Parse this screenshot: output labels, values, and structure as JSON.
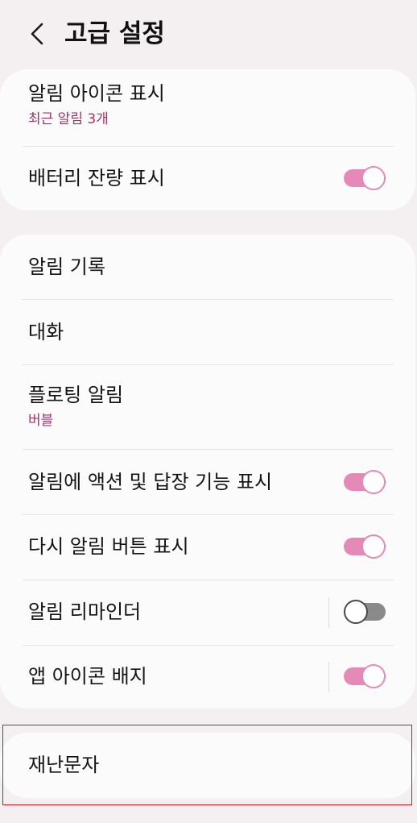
{
  "header": {
    "title": "고급 설정",
    "back_icon": "chevron-left-icon"
  },
  "colors": {
    "background": "#f4f0f1",
    "card": "#fcfbfb",
    "accent": "#e58ab8",
    "subtitle": "#a5316b",
    "toggle_off": "#8a8a8a",
    "highlight_border": "#e8101f"
  },
  "card1": {
    "notification_icons": {
      "title": "알림 아이콘 표시",
      "subtitle": "최근 알림 3개"
    },
    "battery_percentage": {
      "title": "배터리 잔량 표시",
      "toggle_on": true
    }
  },
  "card2": {
    "notification_history": {
      "title": "알림 기록"
    },
    "conversations": {
      "title": "대화"
    },
    "floating_notifications": {
      "title": "플로팅 알림",
      "subtitle": "버블"
    },
    "suggest_actions": {
      "title": "알림에 액션 및 답장 기능 표시",
      "toggle_on": true
    },
    "snooze_button": {
      "title": "다시 알림 버튼 표시",
      "toggle_on": true
    },
    "reminders": {
      "title": "알림 리마인더",
      "toggle_on": false
    },
    "app_icon_badges": {
      "title": "앱 아이콘 배지",
      "toggle_on": true
    }
  },
  "card3": {
    "emergency_alerts": {
      "title": "재난문자"
    }
  }
}
